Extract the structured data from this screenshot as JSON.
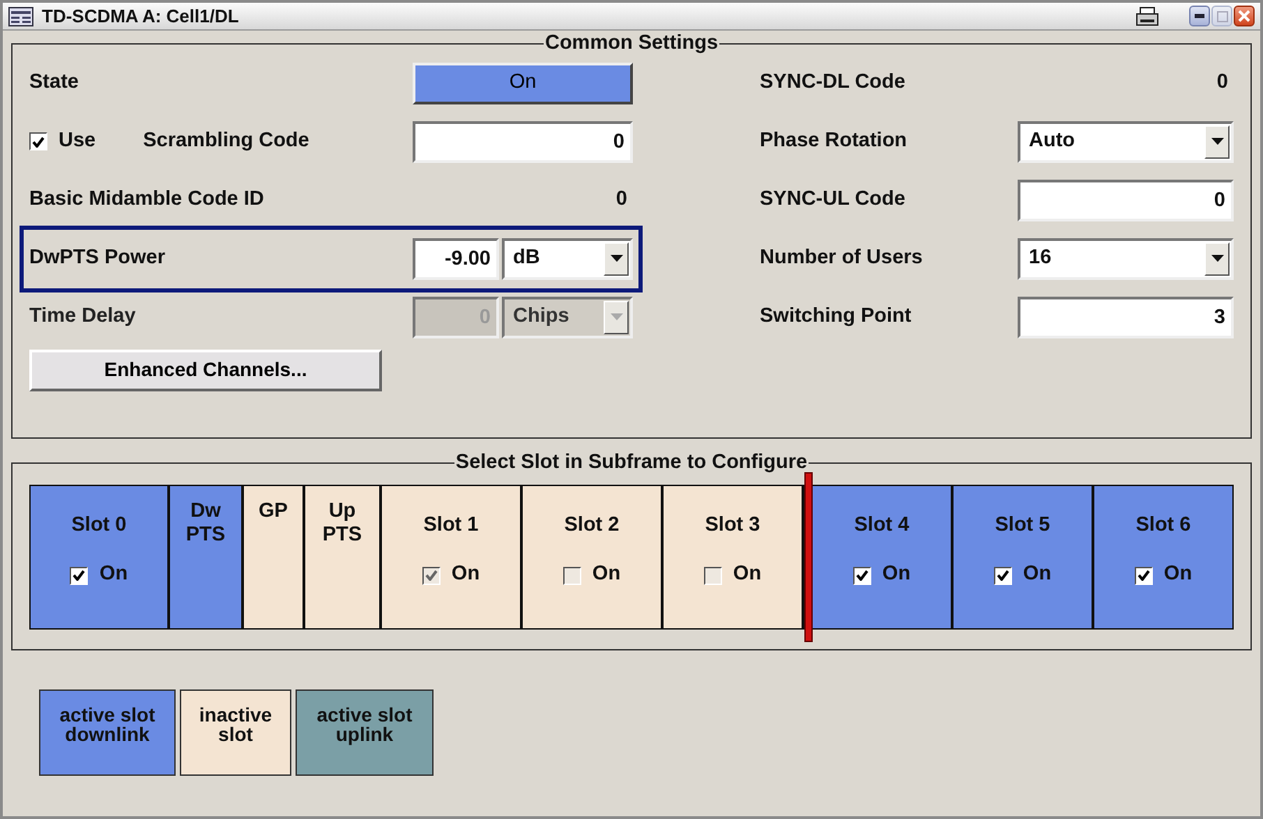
{
  "window": {
    "title": "TD-SCDMA A: Cell1/DL"
  },
  "common_settings": {
    "title": "Common Settings",
    "left": [
      {
        "kind": "toggle",
        "label": "State",
        "value": "On",
        "on": true
      },
      {
        "kind": "checkbox_field",
        "checkbox_label": "Use",
        "checked": true,
        "label": "Scrambling Code",
        "value": "0"
      },
      {
        "kind": "readout",
        "label": "Basic Midamble Code ID",
        "value": "0"
      },
      {
        "kind": "field_unit",
        "label": "DwPTS Power",
        "value": "-9.00",
        "unit": "dB",
        "focused": true,
        "disabled": false
      },
      {
        "kind": "field_unit",
        "label": "Time Delay",
        "value": "0",
        "unit": "Chips",
        "disabled": true
      }
    ],
    "button": "Enhanced Channels...",
    "right": [
      {
        "kind": "readout",
        "label": "SYNC-DL Code",
        "value": "0"
      },
      {
        "kind": "select",
        "label": "Phase Rotation",
        "value": "Auto"
      },
      {
        "kind": "field",
        "label": "SYNC-UL Code",
        "value": "0"
      },
      {
        "kind": "select",
        "label": "Number of Users",
        "value": "16"
      },
      {
        "kind": "field",
        "label": "Switching Point",
        "value": "3"
      }
    ]
  },
  "slot_section": {
    "title": "Select Slot in Subframe to Configure",
    "slots": [
      {
        "kind": "slot",
        "label": "Slot 0",
        "color": "#6a8be3",
        "on": true,
        "disabled": false,
        "on_label": "On"
      },
      {
        "kind": "special",
        "label": "Dw\nPTS",
        "color": "#6a8be3"
      },
      {
        "kind": "special",
        "label": "GP",
        "color": "#f4e4d2"
      },
      {
        "kind": "special",
        "label": "Up\nPTS",
        "color": "#f4e4d2"
      },
      {
        "kind": "slot",
        "label": "Slot 1",
        "color": "#f4e4d2",
        "on": true,
        "disabled": true,
        "on_label": "On"
      },
      {
        "kind": "slot",
        "label": "Slot 2",
        "color": "#f4e4d2",
        "on": false,
        "disabled": true,
        "on_label": "On"
      },
      {
        "kind": "slot",
        "label": "Slot 3",
        "color": "#f4e4d2",
        "on": false,
        "disabled": true,
        "on_label": "On"
      },
      {
        "kind": "switch_point"
      },
      {
        "kind": "slot",
        "label": "Slot 4",
        "color": "#6a8be3",
        "on": true,
        "disabled": false,
        "on_label": "On"
      },
      {
        "kind": "slot",
        "label": "Slot 5",
        "color": "#6a8be3",
        "on": true,
        "disabled": false,
        "on_label": "On"
      },
      {
        "kind": "slot",
        "label": "Slot 6",
        "color": "#6a8be3",
        "on": true,
        "disabled": false,
        "on_label": "On"
      }
    ]
  },
  "legend": [
    {
      "label": "active slot\ndownlink",
      "color": "#6a8be3"
    },
    {
      "label": "inactive\nslot",
      "color": "#f4e4d2"
    },
    {
      "label": "active slot\nuplink",
      "color": "#7b9fa6"
    }
  ]
}
